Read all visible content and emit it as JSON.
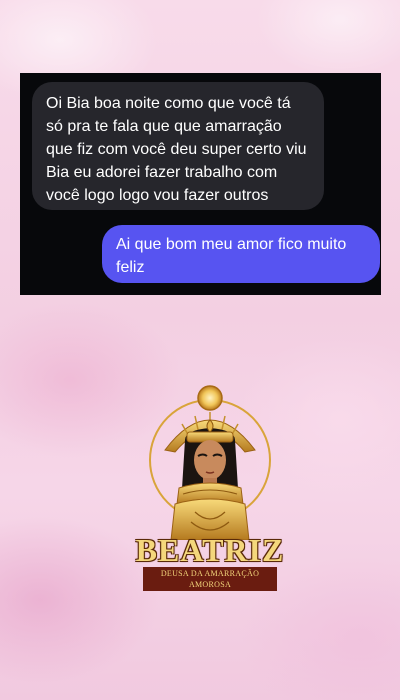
{
  "chat": {
    "messages": [
      {
        "direction": "incoming",
        "text": "Oi Bia boa noite como que você tá só pra te fala que que amarração que fiz com você deu super certo viu Bia eu adorei fazer trabalho com você logo logo vou fazer outros"
      },
      {
        "direction": "outgoing",
        "text": "Ai que bom meu amor fico muito feliz"
      }
    ]
  },
  "brand": {
    "name": "BEATRIZ",
    "tagline": "DEUSA DA AMARRAÇÃO AMOROSA"
  },
  "colors": {
    "background": "#f5d3e5",
    "chat_background": "#07080b",
    "incoming_bubble": "#26262c",
    "outgoing_bubble": "#5754f1",
    "gold": "#f4d77c",
    "brand_ribbon": "#6a1c10"
  },
  "icons": {
    "logo_figure": "egyptian-goddess-illustration"
  }
}
